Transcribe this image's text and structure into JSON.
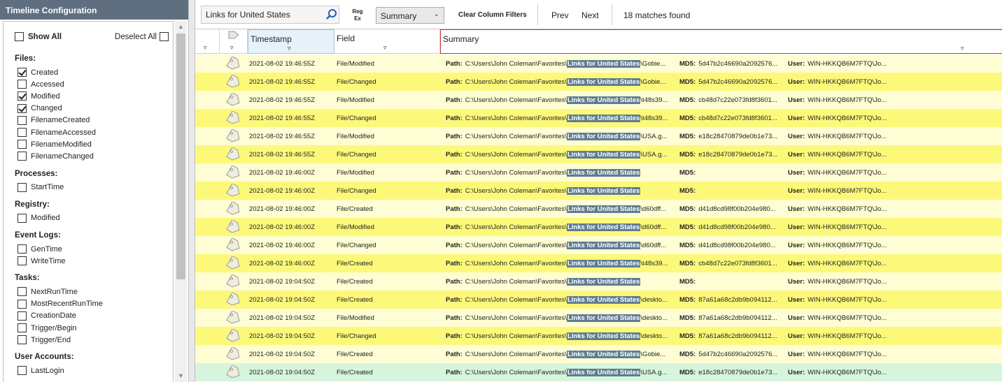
{
  "left_panel": {
    "title": "Timeline Configuration",
    "show_all_label": "Show All",
    "deselect_all_label": "Deselect All",
    "sections": [
      {
        "title": "Files:",
        "items": [
          {
            "label": "Created",
            "checked": true
          },
          {
            "label": "Accessed",
            "checked": false
          },
          {
            "label": "Modified",
            "checked": true
          },
          {
            "label": "Changed",
            "checked": true
          },
          {
            "label": "FilenameCreated",
            "checked": false
          },
          {
            "label": "FilenameAccessed",
            "checked": false
          },
          {
            "label": "FilenameModified",
            "checked": false
          },
          {
            "label": "FilenameChanged",
            "checked": false
          }
        ]
      },
      {
        "title": "Processes:",
        "items": [
          {
            "label": "StartTime",
            "checked": false
          }
        ]
      },
      {
        "title": "Registry:",
        "items": [
          {
            "label": "Modified",
            "checked": false
          }
        ]
      },
      {
        "title": "Event Logs:",
        "items": [
          {
            "label": "GenTime",
            "checked": false
          },
          {
            "label": "WriteTime",
            "checked": false
          }
        ]
      },
      {
        "title": "Tasks:",
        "items": [
          {
            "label": "NextRunTime",
            "checked": false
          },
          {
            "label": "MostRecentRunTime",
            "checked": false
          },
          {
            "label": "CreationDate",
            "checked": false
          },
          {
            "label": "Trigger/Begin",
            "checked": false
          },
          {
            "label": "Trigger/End",
            "checked": false
          }
        ]
      },
      {
        "title": "User Accounts:",
        "items": [
          {
            "label": "LastLogin",
            "checked": false
          }
        ]
      }
    ]
  },
  "toolbar": {
    "search_value": "Links for United States",
    "regex_line1": "Reg",
    "regex_line2": "Ex",
    "view_select": "Summary",
    "clear_filters": "Clear Column Filters",
    "prev": "Prev",
    "next": "Next",
    "matches": "18 matches found"
  },
  "grid": {
    "columns": {
      "timestamp": "Timestamp",
      "field": "Field",
      "summary": "Summary"
    },
    "labels": {
      "path": "Path:",
      "md5": "MD5:",
      "user": "User:"
    },
    "path_prefix": "C:\\Users\\John Coleman\\Favorites\\",
    "highlight": "Links for United States",
    "rows": [
      {
        "ts": "2021-08-02 19:46:55Z",
        "field": "File/Modified",
        "path_suffix": "\\Gobie...",
        "md5": "5d47b2c46690a2092576...",
        "user": "WIN-HKKQB6M7FTQ\\Jo..."
      },
      {
        "ts": "2021-08-02 19:46:55Z",
        "field": "File/Changed",
        "path_suffix": "\\Gobie...",
        "md5": "5d47b2c46690a2092576...",
        "user": "WIN-HKKQB6M7FTQ\\Jo..."
      },
      {
        "ts": "2021-08-02 19:46:55Z",
        "field": "File/Modified",
        "path_suffix": "\\t48s39...",
        "md5": "cb48d7c22e073fd8f3601...",
        "user": "WIN-HKKQB6M7FTQ\\Jo..."
      },
      {
        "ts": "2021-08-02 19:46:55Z",
        "field": "File/Changed",
        "path_suffix": "\\t48s39...",
        "md5": "cb48d7c22e073fd8f3601...",
        "user": "WIN-HKKQB6M7FTQ\\Jo..."
      },
      {
        "ts": "2021-08-02 19:46:55Z",
        "field": "File/Modified",
        "path_suffix": "\\USA.g...",
        "md5": "e18c28470879de0b1e73...",
        "user": "WIN-HKKQB6M7FTQ\\Jo..."
      },
      {
        "ts": "2021-08-02 19:46:55Z",
        "field": "File/Changed",
        "path_suffix": "\\USA.g...",
        "md5": "e18c28470879de0b1e73...",
        "user": "WIN-HKKQB6M7FTQ\\Jo..."
      },
      {
        "ts": "2021-08-02 19:46:00Z",
        "field": "File/Modified",
        "path_suffix": "",
        "md5": "",
        "user": "WIN-HKKQB6M7FTQ\\Jo..."
      },
      {
        "ts": "2021-08-02 19:46:00Z",
        "field": "File/Changed",
        "path_suffix": "",
        "md5": "",
        "user": "WIN-HKKQB6M7FTQ\\Jo..."
      },
      {
        "ts": "2021-08-02 19:46:00Z",
        "field": "File/Created",
        "path_suffix": "\\d60dff...",
        "md5": "d41d8cd98f00b204e980...",
        "user": "WIN-HKKQB6M7FTQ\\Jo..."
      },
      {
        "ts": "2021-08-02 19:46:00Z",
        "field": "File/Modified",
        "path_suffix": "\\d60dff...",
        "md5": "d41d8cd98f00b204e980...",
        "user": "WIN-HKKQB6M7FTQ\\Jo..."
      },
      {
        "ts": "2021-08-02 19:46:00Z",
        "field": "File/Changed",
        "path_suffix": "\\d60dff...",
        "md5": "d41d8cd98f00b204e980...",
        "user": "WIN-HKKQB6M7FTQ\\Jo..."
      },
      {
        "ts": "2021-08-02 19:46:00Z",
        "field": "File/Created",
        "path_suffix": "\\t48s39...",
        "md5": "cb48d7c22e073fd8f3601...",
        "user": "WIN-HKKQB6M7FTQ\\Jo..."
      },
      {
        "ts": "2021-08-02 19:04:50Z",
        "field": "File/Created",
        "path_suffix": "",
        "md5": "",
        "user": "WIN-HKKQB6M7FTQ\\Jo..."
      },
      {
        "ts": "2021-08-02 19:04:50Z",
        "field": "File/Created",
        "path_suffix": "\\deskto...",
        "md5": "87a61a68c2db9b094112...",
        "user": "WIN-HKKQB6M7FTQ\\Jo..."
      },
      {
        "ts": "2021-08-02 19:04:50Z",
        "field": "File/Modified",
        "path_suffix": "\\deskto...",
        "md5": "87a61a68c2db9b094112...",
        "user": "WIN-HKKQB6M7FTQ\\Jo..."
      },
      {
        "ts": "2021-08-02 19:04:50Z",
        "field": "File/Changed",
        "path_suffix": "\\deskto...",
        "md5": "87a61a68c2db9b094112...",
        "user": "WIN-HKKQB6M7FTQ\\Jo..."
      },
      {
        "ts": "2021-08-02 19:04:50Z",
        "field": "File/Created",
        "path_suffix": "\\Gobie...",
        "md5": "5d47b2c46690a2092576...",
        "user": "WIN-HKKQB6M7FTQ\\Jo..."
      },
      {
        "ts": "2021-08-02 19:04:50Z",
        "field": "File/Created",
        "path_suffix": "\\USA.g...",
        "md5": "e18c28470879de0b1e73...",
        "user": "WIN-HKKQB6M7FTQ\\Jo..."
      }
    ]
  },
  "colors": {
    "row_odd": "#fefdd3",
    "row_even": "#fcf97a",
    "row_selected": "#d6f5dc",
    "highlight_bg": "#5f7d92",
    "panel_title_bg": "#5f6f80"
  }
}
